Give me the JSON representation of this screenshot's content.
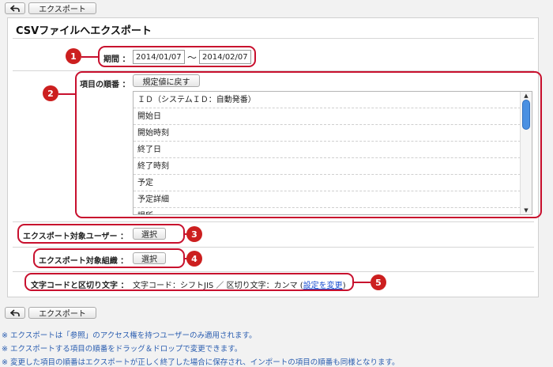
{
  "toolbar": {
    "back_icon": "back-arrow-icon",
    "export_label": "エクスポート"
  },
  "page_title": "CSVファイルへエクスポート",
  "period": {
    "label": "期間 ：",
    "from": "2014/01/07",
    "separator": "〜",
    "to": "2014/02/07"
  },
  "order": {
    "label": "項目の順番 ：",
    "reset_label": "規定値に戻す",
    "items": [
      "ＩＤ（システムＩＤ：自動発番）",
      "開始日",
      "開始時刻",
      "終了日",
      "終了時刻",
      "予定",
      "予定詳細",
      "場所"
    ]
  },
  "users": {
    "label": "エクスポート対象ユーザー ：",
    "select_label": "選択"
  },
  "orgs": {
    "label": "エクスポート対象組織 ：",
    "select_label": "選択"
  },
  "encoding": {
    "label": "文字コードと区切り文字 ：",
    "value": "文字コード：シフトJIS ／ 区切り文字：カンマ (",
    "link": "設定を変更",
    "close": ")"
  },
  "badges": [
    "1",
    "2",
    "3",
    "4",
    "5"
  ],
  "notes": [
    "※ エクスポートは「参照」のアクセス権を持つユーザーのみ適用されます。",
    "※ エクスポートする項目の順番をドラッグ＆ドロップで変更できます。",
    "※ 変更した項目の順番はエクスポートが正しく終了した場合に保存され、インポートの項目の順番も同様となります。"
  ],
  "colors": {
    "callout": "#c8102e",
    "note": "#2a5db0",
    "link": "#1a4fd1",
    "scroll": "#4a90e2"
  }
}
